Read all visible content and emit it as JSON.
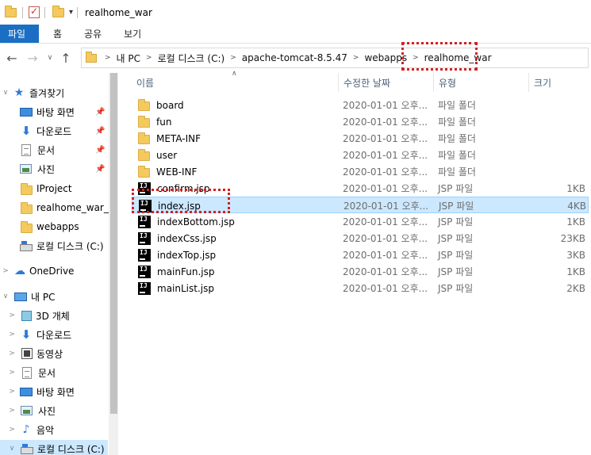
{
  "window": {
    "title": "realhome_war"
  },
  "ribbon": {
    "tabs": [
      "파일",
      "홈",
      "공유",
      "보기"
    ]
  },
  "address": {
    "crumbs": [
      "내 PC",
      "로컬 디스크 (C:)",
      "apache-tomcat-8.5.47",
      "webapps",
      "realhome_war"
    ]
  },
  "sidebar": {
    "quick_access": "즐겨찾기",
    "pinned": [
      "바탕 화면",
      "다운로드",
      "문서",
      "사진"
    ],
    "recent": [
      "IProject",
      "realhome_war_e",
      "webapps",
      "로컬 디스크 (C:)"
    ],
    "onedrive": "OneDrive",
    "this_pc": "내 PC",
    "pc_items": [
      "3D 개체",
      "다운로드",
      "동영상",
      "문서",
      "바탕 화면",
      "사진",
      "음악",
      "로컬 디스크 (C:)"
    ]
  },
  "columns": {
    "name": "이름",
    "date": "수정한 날짜",
    "type": "유형",
    "size": "크기"
  },
  "files": [
    {
      "name": "board",
      "date": "2020-01-01 오후...",
      "type": "파일 폴더",
      "size": "",
      "icon": "folder-icon"
    },
    {
      "name": "fun",
      "date": "2020-01-01 오후...",
      "type": "파일 폴더",
      "size": "",
      "icon": "folder-icon"
    },
    {
      "name": "META-INF",
      "date": "2020-01-01 오후...",
      "type": "파일 폴더",
      "size": "",
      "icon": "folder-icon"
    },
    {
      "name": "user",
      "date": "2020-01-01 오후...",
      "type": "파일 폴더",
      "size": "",
      "icon": "folder-icon"
    },
    {
      "name": "WEB-INF",
      "date": "2020-01-01 오후...",
      "type": "파일 폴더",
      "size": "",
      "icon": "folder-icon"
    },
    {
      "name": "confirm.jsp",
      "date": "2020-01-01 오후...",
      "type": "JSP 파일",
      "size": "1KB",
      "icon": "jsp-file-icon"
    },
    {
      "name": "index.jsp",
      "date": "2020-01-01 오후...",
      "type": "JSP 파일",
      "size": "4KB",
      "icon": "jsp-file-icon"
    },
    {
      "name": "indexBottom.jsp",
      "date": "2020-01-01 오후...",
      "type": "JSP 파일",
      "size": "1KB",
      "icon": "jsp-file-icon"
    },
    {
      "name": "indexCss.jsp",
      "date": "2020-01-01 오후...",
      "type": "JSP 파일",
      "size": "23KB",
      "icon": "jsp-file-icon"
    },
    {
      "name": "indexTop.jsp",
      "date": "2020-01-01 오후...",
      "type": "JSP 파일",
      "size": "3KB",
      "icon": "jsp-file-icon"
    },
    {
      "name": "mainFun.jsp",
      "date": "2020-01-01 오후...",
      "type": "JSP 파일",
      "size": "1KB",
      "icon": "jsp-file-icon"
    },
    {
      "name": "mainList.jsp",
      "date": "2020-01-01 오후...",
      "type": "JSP 파일",
      "size": "2KB",
      "icon": "jsp-file-icon"
    }
  ],
  "selected_file": "index.jsp",
  "colors": {
    "accent": "#1a6fc4",
    "selection": "#cce8ff",
    "highlight": "#d61f1f"
  }
}
